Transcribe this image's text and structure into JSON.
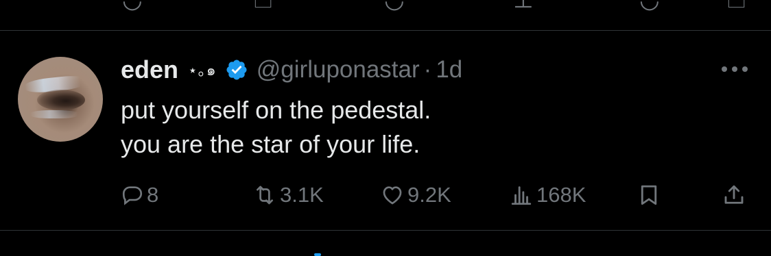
{
  "colors": {
    "background": "#000000",
    "text": "#e7e9ea",
    "muted": "#71767b",
    "divider": "#2f3336",
    "verified": "#1d9bf0"
  },
  "tweet": {
    "display_name": "eden",
    "name_decoration": "⋆｡๑",
    "handle": "@girluponastar",
    "separator": "·",
    "timestamp": "1d",
    "text_lines": [
      "put yourself on the pedestal.",
      "you are the star of your life."
    ],
    "verified_icon": "verified-badge-icon",
    "more_icon": "more-options-icon",
    "stats": {
      "replies": "8",
      "reposts": "3.1K",
      "likes": "9.2K",
      "views": "168K"
    }
  }
}
